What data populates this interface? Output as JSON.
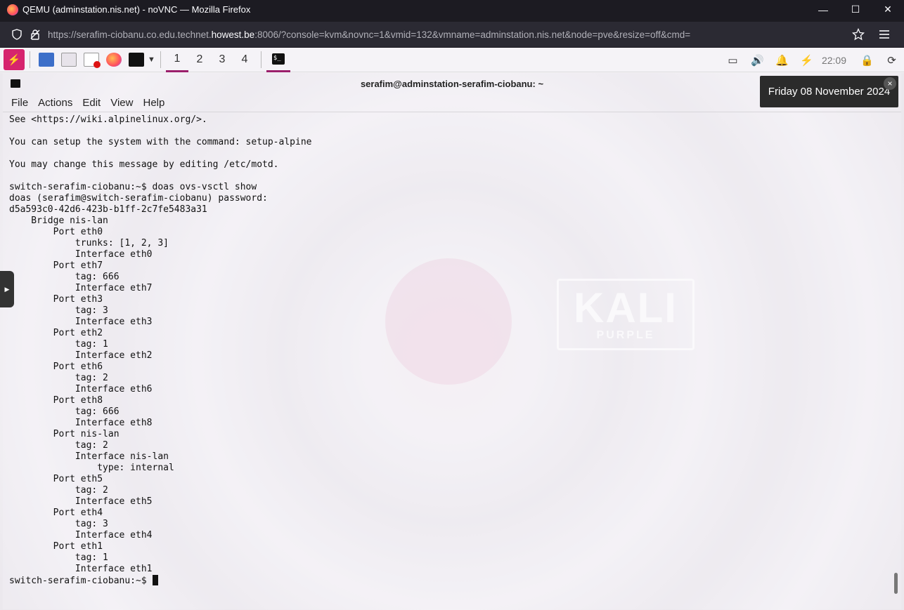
{
  "browser": {
    "window_title": "QEMU (adminstation.nis.net) - noVNC — Mozilla Firefox",
    "url_prefix": "https://serafim-ciobanu.co.edu.technet.",
    "url_host": "howest.be",
    "url_suffix": ":8006/?console=kvm&novnc=1&vmid=132&vmname=adminstation.nis.net&node=pve&resize=off&cmd=",
    "minimize": "—",
    "maximize": "☐",
    "close": "✕"
  },
  "panel": {
    "workspaces": [
      "1",
      "2",
      "3",
      "4"
    ],
    "active_workspace": "1",
    "clock": "22:09"
  },
  "tooltip": "Friday 08 November 2024",
  "wallpaper": {
    "logo_main": "KALI",
    "logo_sub": "PURPLE"
  },
  "terminal": {
    "title": "serafim@adminstation-serafim-ciobanu: ~",
    "menu": [
      "File",
      "Actions",
      "Edit",
      "View",
      "Help"
    ],
    "lines": [
      "See <https://wiki.alpinelinux.org/>.",
      "",
      "You can setup the system with the command: setup-alpine",
      "",
      "You may change this message by editing /etc/motd.",
      "",
      "switch-serafim-ciobanu:~$ doas ovs-vsctl show",
      "doas (serafim@switch-serafim-ciobanu) password:",
      "d5a593c0-42d6-423b-b1ff-2c7fe5483a31",
      "    Bridge nis-lan",
      "        Port eth0",
      "            trunks: [1, 2, 3]",
      "            Interface eth0",
      "        Port eth7",
      "            tag: 666",
      "            Interface eth7",
      "        Port eth3",
      "            tag: 3",
      "            Interface eth3",
      "        Port eth2",
      "            tag: 1",
      "            Interface eth2",
      "        Port eth6",
      "            tag: 2",
      "            Interface eth6",
      "        Port eth8",
      "            tag: 666",
      "            Interface eth8",
      "        Port nis-lan",
      "            tag: 2",
      "            Interface nis-lan",
      "                type: internal",
      "        Port eth5",
      "            tag: 2",
      "            Interface eth5",
      "        Port eth4",
      "            tag: 3",
      "            Interface eth4",
      "        Port eth1",
      "            tag: 1",
      "            Interface eth1"
    ],
    "prompt": "switch-serafim-ciobanu:~$ "
  },
  "colors": {
    "kali_accent": "#9b1f6b",
    "kali_menu": "#d6246e",
    "tooltip_bg": "#2b2b2b"
  }
}
